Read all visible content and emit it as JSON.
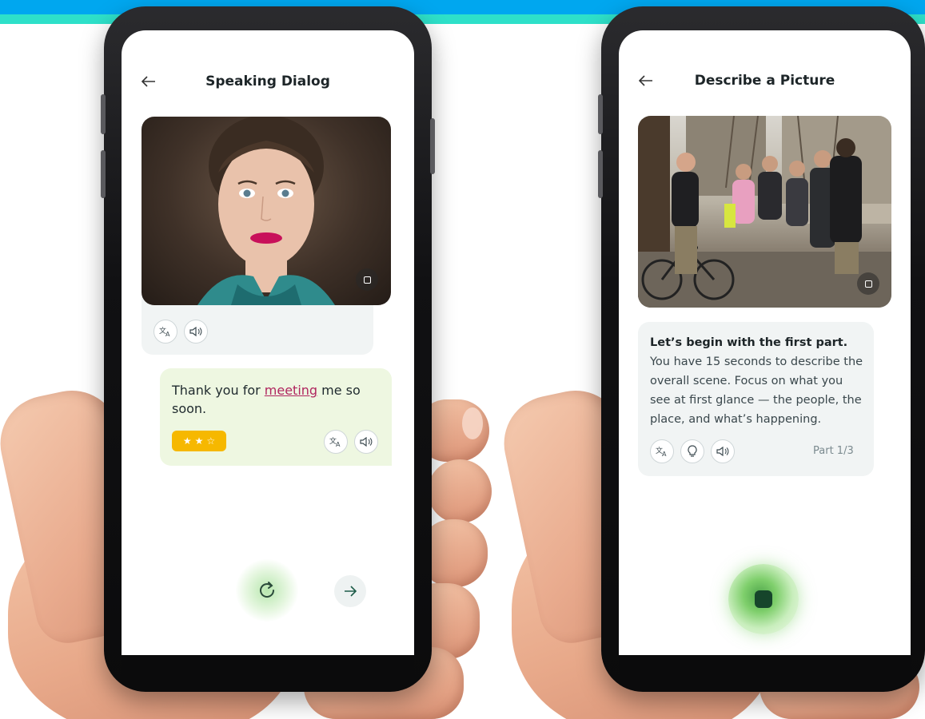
{
  "colors": {
    "band_blue": "#00a7ef",
    "band_teal": "#2ee0c9",
    "accent_green": "#2f6e3c",
    "link": "#b0265f",
    "stars": "#f6b800",
    "bubble_user": "#eef7e1",
    "bubble_bot": "#f1f4f4"
  },
  "left_screen": {
    "title": "Speaking Dialog",
    "back_icon": "arrow-left-icon",
    "ai_bubble": {
      "icons": [
        "translate-icon",
        "speaker-icon"
      ]
    },
    "user_bubble": {
      "text_before": "Thank you for ",
      "highlight": "meeting",
      "text_after": " me so soon.",
      "stars_filled": 2,
      "stars_total": 3,
      "icons": [
        "translate-icon",
        "speaker-icon"
      ]
    },
    "controls": {
      "retry_icon": "refresh-icon",
      "next_icon": "arrow-right-icon"
    }
  },
  "right_screen": {
    "title": "Describe a Picture",
    "back_icon": "arrow-left-icon",
    "message": {
      "bold": "Let’s begin with the first part.",
      "text": " You have 15 seconds to describe the overall scene. Focus on what you see at first glance — the people, the place, and what’s happening.",
      "part": "Part 1/3",
      "icons": [
        "translate-icon",
        "hint-icon",
        "speaker-icon"
      ]
    },
    "controls": {
      "stop_icon": "stop-icon"
    }
  }
}
